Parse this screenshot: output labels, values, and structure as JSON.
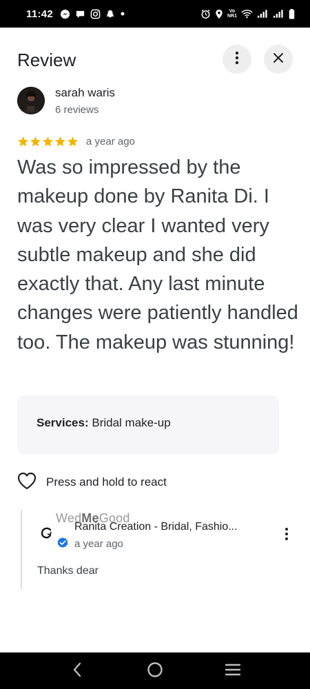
{
  "status_bar": {
    "time": "11:42",
    "left_icons": [
      "messenger-icon",
      "chat-icon",
      "instagram-icon",
      "snapchat-icon",
      "dot-icon"
    ],
    "right_icons": [
      "alarm-icon",
      "location-icon",
      "volte-icon",
      "wifi-icon",
      "signal-icon",
      "signal-icon",
      "battery-icon"
    ],
    "volte_top": "Vo",
    "volte_bottom": "NR1"
  },
  "header": {
    "title": "Review",
    "more_icon": "more-vert-icon",
    "close_icon": "close-icon"
  },
  "reviewer": {
    "name": "sarah waris",
    "review_count": "6 reviews"
  },
  "rating": {
    "stars": 5,
    "max_stars": 5,
    "star_color": "#f4b400",
    "time": "a year ago"
  },
  "review_text": "Was so impressed by the makeup done by Ranita Di. I was very clear I wanted very subtle makeup and she did exactly that. Any last minute changes were patiently handled too. The makeup was stunning!",
  "services": {
    "label": "Services:",
    "value": "Bridal make-up"
  },
  "react": {
    "icon": "heart-outline-icon",
    "label": "Press and hold to react"
  },
  "owner_reply": {
    "watermark_prefix": "Wed",
    "watermark_bold": "Me",
    "watermark_suffix": "Good",
    "owner_name": "Ranita Creation - Bridal, Fashio...",
    "time": "a year ago",
    "text": "Thanks dear",
    "verified_color": "#1a73e8"
  },
  "nav_bar": {
    "icons": [
      "back-icon",
      "home-icon",
      "recents-icon"
    ]
  }
}
